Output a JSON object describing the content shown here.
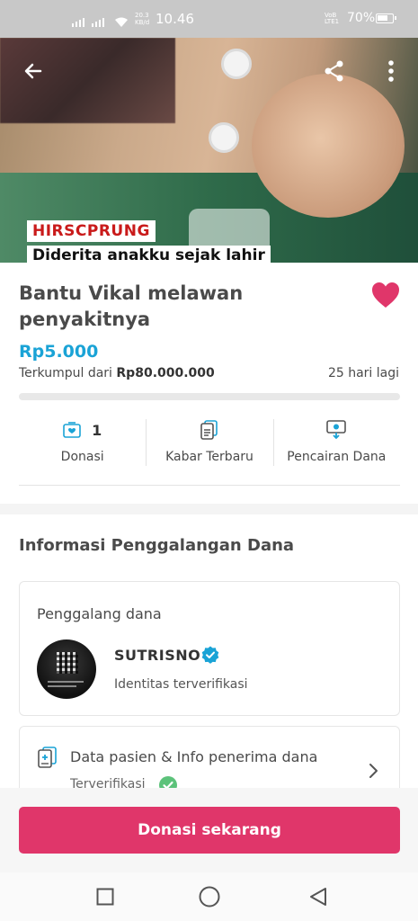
{
  "status_bar": {
    "time": "10.46",
    "net_speed_value": "20.3",
    "net_speed_unit": "KB/d",
    "lte_top": "VoB",
    "lte_bottom": "LTE1",
    "battery_percent": "70%",
    "battery_level": 0.7
  },
  "hero": {
    "caption_line1": "HIRSCPRUNG",
    "caption_line2": "Diderita anakku sejak lahir",
    "icons": [
      "back-arrow-icon",
      "share-icon",
      "more-vertical-icon"
    ]
  },
  "campaign": {
    "title": "Bantu Vikal melawan penyakitnya",
    "amount_raised": "Rp5.000",
    "collected_prefix": "Terkumpul dari",
    "target_amount": "Rp80.000.000",
    "days_left": "25 hari lagi",
    "progress_fraction": 0.0001,
    "accent_color": "#1aa3d6",
    "favorite_color": "#e0366a"
  },
  "stats": {
    "donations_count": "1",
    "donations_label": "Donasi",
    "updates_label": "Kabar Terbaru",
    "disbursement_label": "Pencairan Dana"
  },
  "info_section": {
    "title": "Informasi Penggalangan Dana",
    "fundraiser_label": "Penggalang dana",
    "fundraiser_name": "SUTRISNO",
    "fundraiser_status": "Identitas terverifikasi",
    "patient_title": "Data pasien & Info penerima dana",
    "patient_status": "Terverifikasi"
  },
  "cta": {
    "donate_label": "Donasi sekarang",
    "button_color": "#e0366a"
  },
  "nav": {
    "icons": [
      "recents-square-icon",
      "home-circle-icon",
      "back-triangle-icon"
    ]
  }
}
